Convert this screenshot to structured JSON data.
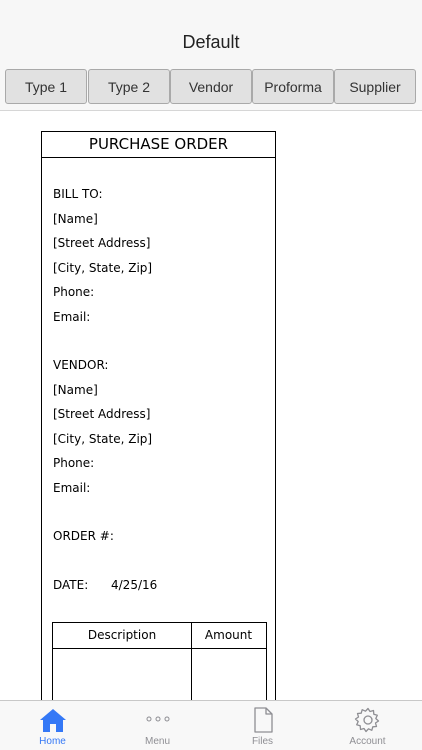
{
  "nav": {
    "title": "Default"
  },
  "segments": [
    "Type 1",
    "Type 2",
    "Vendor",
    "Proforma",
    "Supplier"
  ],
  "document": {
    "heading": "PURCHASE ORDER",
    "bill_to": {
      "label": "BILL TO:",
      "name": "[Name]",
      "street": "[Street Address]",
      "city": "[City, State, Zip]",
      "phone": "Phone:",
      "email": "Email:"
    },
    "vendor": {
      "label": "VENDOR:",
      "name": "[Name]",
      "street": "[Street Address]",
      "city": "[City, State, Zip]",
      "phone": "Phone:",
      "email": "Email:"
    },
    "order_label": "ORDER #:",
    "date_label": "DATE:",
    "date_value": "4/25/16",
    "table": {
      "col_description": "Description",
      "col_amount": "Amount"
    }
  },
  "tabs": [
    {
      "label": "Home",
      "icon": "home-icon",
      "active": true
    },
    {
      "label": "Menu",
      "icon": "more-icon",
      "active": false
    },
    {
      "label": "Files",
      "icon": "file-icon",
      "active": false
    },
    {
      "label": "Account",
      "icon": "gear-icon",
      "active": false
    }
  ],
  "colors": {
    "accent": "#3478f6",
    "inactive": "#8e8e93"
  }
}
